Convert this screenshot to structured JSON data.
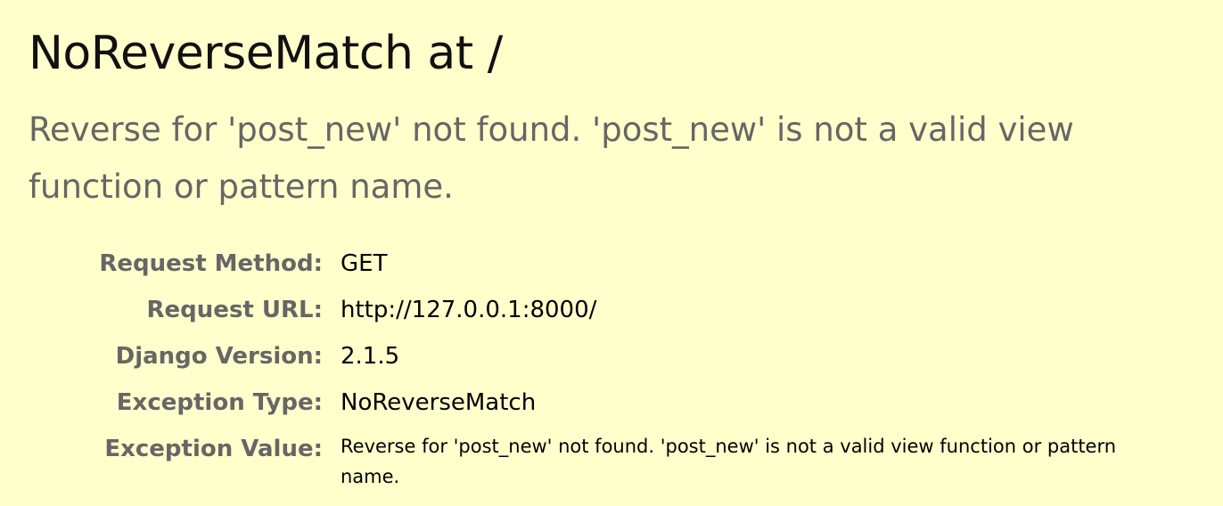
{
  "summary": {
    "title": "NoReverseMatch at /",
    "exception_message": "Reverse for 'post_new' not found. 'post_new' is not a valid view function or pattern name."
  },
  "meta": {
    "request_method": {
      "label": "Request Method:",
      "value": "GET"
    },
    "request_url": {
      "label": "Request URL:",
      "value": "http://127.0.0.1:8000/"
    },
    "django_version": {
      "label": "Django Version:",
      "value": "2.1.5"
    },
    "exception_type": {
      "label": "Exception Type:",
      "value": "NoReverseMatch"
    },
    "exception_value": {
      "label": "Exception Value:",
      "value": "Reverse for 'post_new' not found. 'post_new' is not a valid view function or pattern name."
    }
  },
  "colors": {
    "background": "#ffffcc",
    "label_gray": "#666666",
    "text": "#000000"
  }
}
